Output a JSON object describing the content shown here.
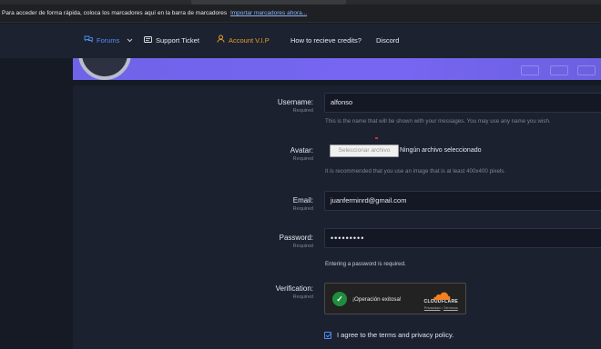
{
  "browser": {
    "bookmarks_text": "Para acceder de forma rápida, coloca los marcadores aquí en la barra de marcadores",
    "bookmarks_link": "Importar marcadores ahora..."
  },
  "nav": {
    "forums": "Forums",
    "support": "Support Ticket",
    "vip": "Account V.I.P",
    "credits": "How to recieve credits?",
    "discord": "Discord"
  },
  "form": {
    "username_label": "Username:",
    "username_req": "Required",
    "username_value": "alfonso",
    "username_hint": "This is the name that will be shown with your messages. You may use any name you wish.",
    "avatar_label": "Avatar:",
    "avatar_req": "Required",
    "avatar_button": "Seleccionar archivo",
    "avatar_status": "Ningún archivo seleccionado",
    "avatar_hint": "It is recommended that you use an image that is at least 400x400 pixels.",
    "email_label": "Email:",
    "email_req": "Required",
    "email_value": "juanferminrd@gmail.com",
    "password_label": "Password:",
    "password_req": "Required",
    "password_value": "•••••••••",
    "password_hint": "Entering a password is required.",
    "verification_label": "Verification:",
    "verification_req": "Required",
    "agree_label": "I agree to the terms and privacy policy."
  },
  "turnstile": {
    "status": "¡Operación exitosa!",
    "brand": "CLOUDFLARE",
    "privacy": "Privacidad",
    "separator": "•",
    "terms": "Términos"
  },
  "colors": {
    "accent_blue": "#4d8ff5",
    "vip_orange": "#e89b2c",
    "banner_purple": "#7766f2",
    "success_green": "#1e8e3e",
    "cloudflare_orange": "#f38020"
  }
}
